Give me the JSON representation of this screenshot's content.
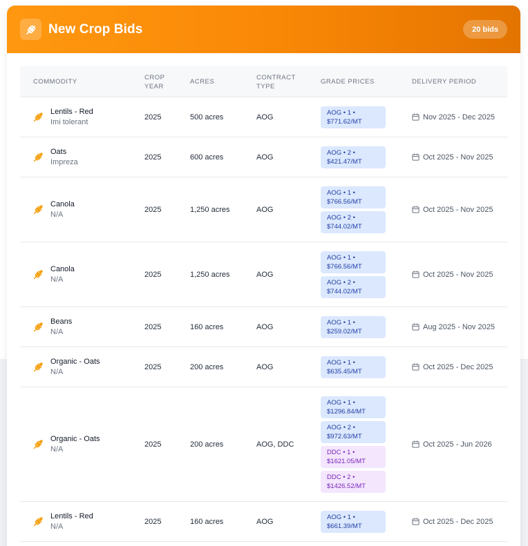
{
  "header": {
    "title": "New Crop Bids",
    "badge": "20 bids"
  },
  "columns": {
    "commodity": "COMMODITY",
    "crop_year": [
      "CROP",
      "YEAR"
    ],
    "acres": "ACRES",
    "contract_type": [
      "CONTRACT",
      "TYPE"
    ],
    "grade_prices": "GRADE PRICES",
    "delivery_period": "DELIVERY PERIOD"
  },
  "colors": {
    "accent": "#f98706",
    "aog_badge_bg": "#dbe8fe",
    "ddc_badge_bg": "#f3e6fd"
  },
  "icons": {
    "header": "wheat-icon",
    "row": "wheat-icon",
    "delivery": "calendar-icon"
  },
  "rows": [
    {
      "name": "Lentils - Red",
      "variety": "Imi tolerant",
      "year": "2025",
      "acres": "500 acres",
      "contract": "AOG",
      "grades": [
        {
          "type": "aog",
          "line1": "AOG • 1 •",
          "line2": "$771.62/MT"
        }
      ],
      "delivery": "Nov 2025 - Dec 2025"
    },
    {
      "name": "Oats",
      "variety": "Impreza",
      "year": "2025",
      "acres": "600 acres",
      "contract": "AOG",
      "grades": [
        {
          "type": "aog",
          "line1": "AOG • 2 •",
          "line2": "$421.47/MT"
        }
      ],
      "delivery": "Oct 2025 - Nov 2025"
    },
    {
      "name": "Canola",
      "variety": "N/A",
      "year": "2025",
      "acres": "1,250 acres",
      "contract": "AOG",
      "grades": [
        {
          "type": "aog",
          "line1": "AOG • 1 •",
          "line2": "$766.56/MT"
        },
        {
          "type": "aog",
          "line1": "AOG • 2 •",
          "line2": "$744.02/MT"
        }
      ],
      "delivery": "Oct 2025 - Nov 2025"
    },
    {
      "name": "Canola",
      "variety": "N/A",
      "year": "2025",
      "acres": "1,250 acres",
      "contract": "AOG",
      "grades": [
        {
          "type": "aog",
          "line1": "AOG • 1 •",
          "line2": "$766.56/MT"
        },
        {
          "type": "aog",
          "line1": "AOG • 2 •",
          "line2": "$744.02/MT"
        }
      ],
      "delivery": "Oct 2025 - Nov 2025"
    },
    {
      "name": "Beans",
      "variety": "N/A",
      "year": "2025",
      "acres": "160 acres",
      "contract": "AOG",
      "grades": [
        {
          "type": "aog",
          "line1": "AOG • 1 •",
          "line2": "$259.02/MT"
        }
      ],
      "delivery": "Aug 2025 - Nov 2025"
    },
    {
      "name": "Organic - Oats",
      "variety": "N/A",
      "year": "2025",
      "acres": "200 acres",
      "contract": "AOG",
      "grades": [
        {
          "type": "aog",
          "line1": "AOG • 1 •",
          "line2": "$635.45/MT"
        }
      ],
      "delivery": "Oct 2025 - Dec 2025"
    },
    {
      "name": "Organic - Oats",
      "variety": "N/A",
      "year": "2025",
      "acres": "200 acres",
      "contract": "AOG, DDC",
      "grades": [
        {
          "type": "aog",
          "line1": "AOG • 1 •",
          "line2": "$1296.84/MT"
        },
        {
          "type": "aog",
          "line1": "AOG • 2 •",
          "line2": "$972.63/MT"
        },
        {
          "type": "ddc",
          "line1": "DDC • 1 •",
          "line2": "$1621.05/MT"
        },
        {
          "type": "ddc",
          "line1": "DDC • 2 •",
          "line2": "$1426.52/MT"
        }
      ],
      "delivery": "Oct 2025 - Jun 2026"
    },
    {
      "name": "Lentils - Red",
      "variety": "N/A",
      "year": "2025",
      "acres": "160 acres",
      "contract": "AOG",
      "grades": [
        {
          "type": "aog",
          "line1": "AOG • 1 •",
          "line2": "$661.39/MT"
        }
      ],
      "delivery": "Oct 2025 - Dec 2025"
    }
  ]
}
